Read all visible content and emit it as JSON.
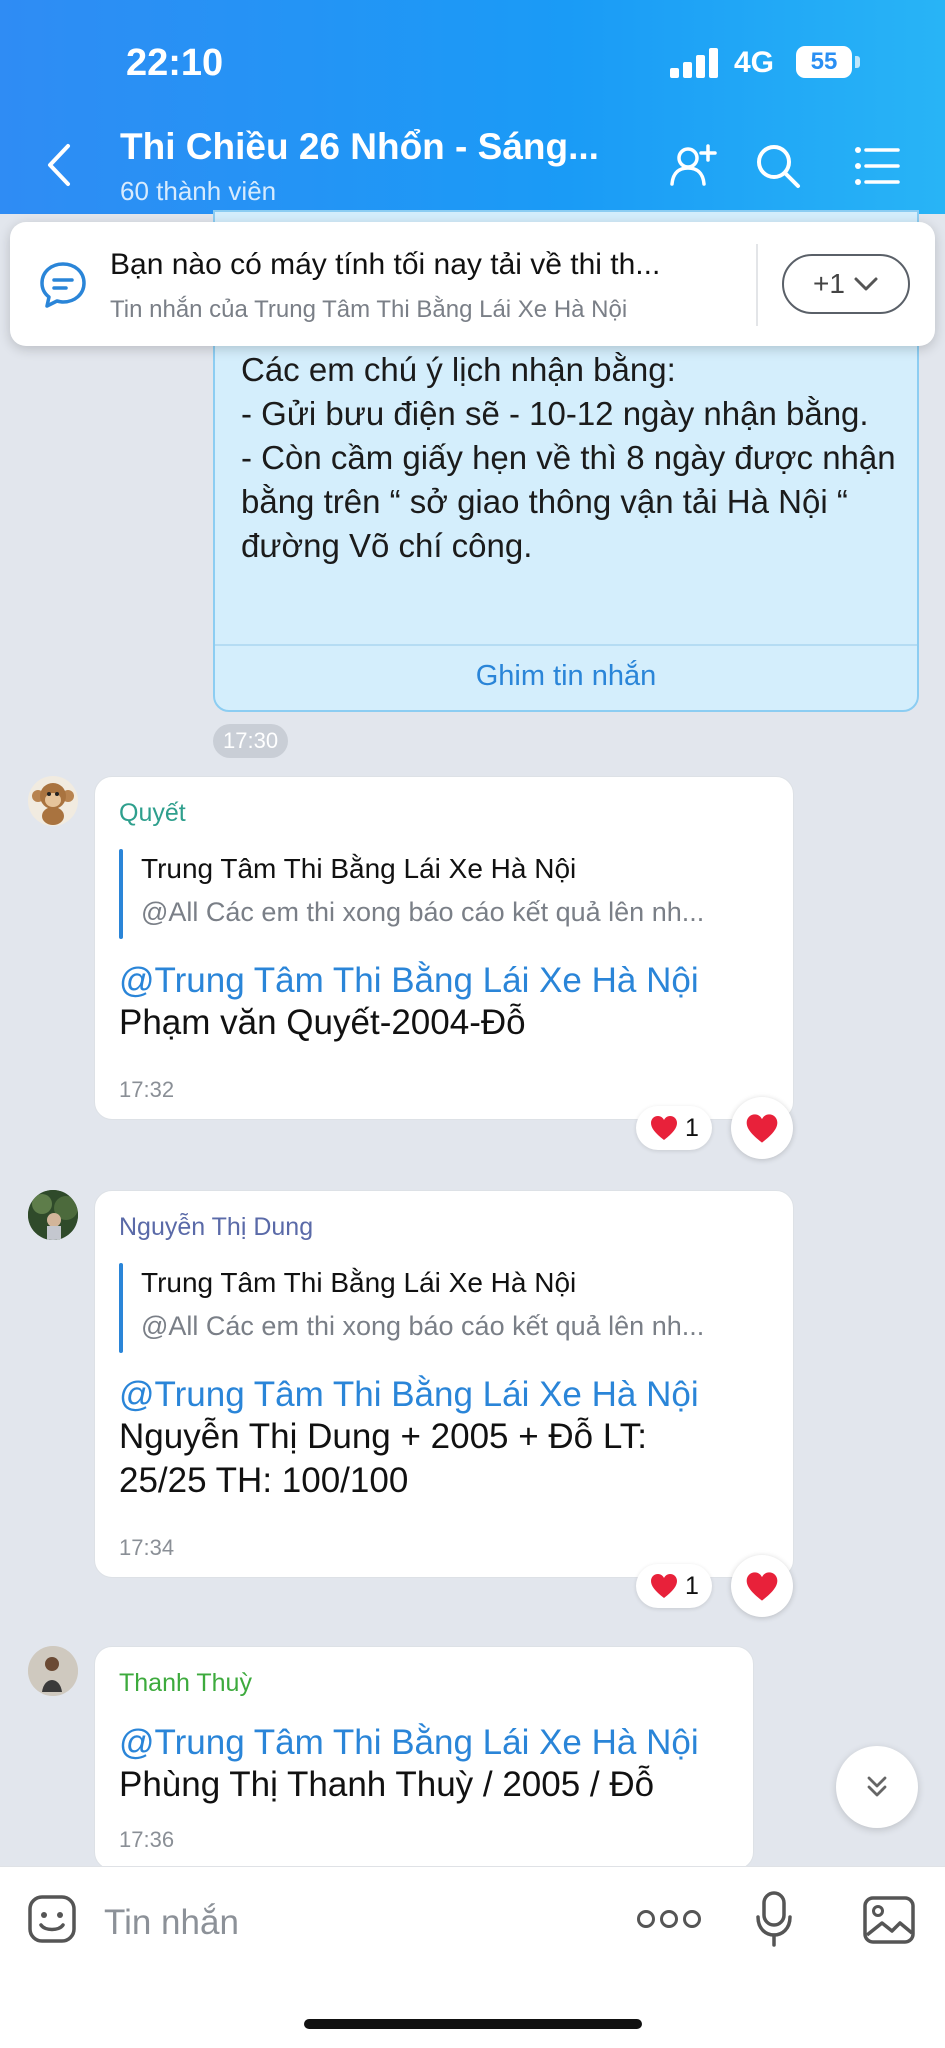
{
  "status_bar": {
    "time": "22:10",
    "network": "4G",
    "battery": "55"
  },
  "header": {
    "title": "Thi Chiều 26 Nhổn - Sáng...",
    "subtitle": "60 thành viên"
  },
  "pinned": {
    "text": "Bạn nào có máy tính tối nay tải về thi th...",
    "sub": "Tin nhắn của Trung Tâm Thi Bằng Lái Xe Hà Nội",
    "more": "+1"
  },
  "top_message": {
    "text": "Các em chú ý lịch nhận bằng:\n- Gửi bưu điện sẽ  - 10-12 ngày nhận bằng.\n- Còn cầm giấy hẹn về thì 8 ngày được nhận bằng trên “ sở giao thông vận tải Hà Nội “ đường Võ chí công.",
    "pin_action": "Ghim tin nhắn",
    "time": "17:30"
  },
  "messages": [
    {
      "sender": "Quyết",
      "sender_color": "#2e9f8d",
      "quote_title": "Trung Tâm Thi Bằng Lái Xe Hà Nội",
      "quote_text": "@All Các em thi xong báo cáo kết quả lên nh...",
      "mention": "@Trung Tâm Thi Bằng Lái Xe Hà Nội",
      "body": "Phạm văn Quyết-2004-Đỗ",
      "time": "17:32",
      "reaction_count": "1"
    },
    {
      "sender": "Nguyễn Thị Dung",
      "sender_color": "#5a6aa8",
      "quote_title": "Trung Tâm Thi Bằng Lái Xe Hà Nội",
      "quote_text": "@All Các em thi xong báo cáo kết quả lên nh...",
      "mention": "@Trung Tâm Thi Bằng Lái Xe Hà Nội",
      "body": "Nguyễn Thị Dung + 2005 + Đỗ LT:\n25/25 TH: 100/100",
      "time": "17:34",
      "reaction_count": "1"
    },
    {
      "sender": "Thanh Thuỳ",
      "sender_color": "#3daa3d",
      "mention": "@Trung Tâm Thi Bằng Lái Xe Hà Nội",
      "body": "Phùng Thị Thanh Thuỳ / 2005 / Đỗ",
      "time": "17:36"
    }
  ],
  "input": {
    "placeholder": "Tin nhắn"
  },
  "icons": {
    "back": "back-icon",
    "add_member": "add-member-icon",
    "search": "search-icon",
    "menu": "menu-icon",
    "pinned": "message-icon",
    "heart": "heart-icon",
    "scroll_down": "double-chevron-down-icon",
    "sticker": "sticker-icon",
    "more": "more-icon",
    "mic": "mic-icon",
    "image": "image-icon"
  },
  "colors": {
    "header": "#2f8cf4",
    "accent": "#2a85d8",
    "heart": "#e8213a",
    "pinned_bubble": "#d4eefc"
  }
}
